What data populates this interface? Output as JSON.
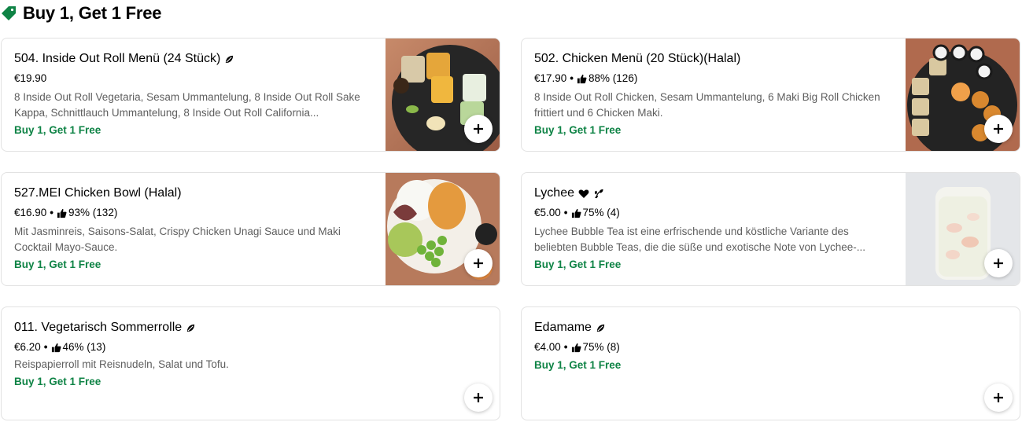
{
  "section": {
    "title": "Buy 1, Get 1 Free",
    "icon": "tag-icon"
  },
  "colors": {
    "promo": "#0e8345",
    "tag_icon": "#0e8345",
    "description": "#5e5e5e"
  },
  "items": [
    {
      "name": "504. Inside Out Roll Menü (24 Stück)",
      "icons": [
        "leaf-icon"
      ],
      "price": "€19.90",
      "rating": "",
      "description": "8 Inside Out Roll Vegetaria, Sesam Ummantelung, 8 Inside Out Roll Sake Kappa, Schnittlauch Ummantelung, 8 Inside Out Roll California...",
      "promo": "Buy 1, Get 1 Free",
      "image": "sushi-platter-image"
    },
    {
      "name": "502. Chicken Menü (20 Stück)(Halal)",
      "icons": [],
      "price": "€17.90",
      "rating": "88% (126)",
      "description": "8 Inside Out Roll Chicken, Sesam Ummantelung, 6 Maki Big Roll Chicken frittiert und 6 Chicken Maki.",
      "promo": "Buy 1, Get 1 Free",
      "image": "chicken-sushi-platter-image"
    },
    {
      "name": "527.MEI Chicken Bowl (Halal)",
      "icons": [],
      "price": "€16.90",
      "rating": "93% (132)",
      "description": "Mit Jasminreis, Saisons-Salat, Crispy Chicken Unagi Sauce und Maki Cocktail Mayo-Sauce.",
      "promo": "Buy 1, Get 1 Free",
      "image": "chicken-bowl-image"
    },
    {
      "name": "Lychee",
      "icons": [
        "heart-icon",
        "vegan-icon"
      ],
      "price": "€5.00",
      "rating": "75% (4)",
      "description": "Lychee Bubble Tea ist eine erfrischende und köstliche Variante des beliebten Bubble Teas, die die süße und exotische Note von Lychee-...",
      "promo": "Buy 1, Get 1 Free",
      "image": "bubble-tea-image"
    },
    {
      "name": "011. Vegetarisch Sommerrolle",
      "icons": [
        "leaf-icon"
      ],
      "price": "€6.20",
      "rating": "46% (13)",
      "description": "Reispapierroll mit Reisnudeln, Salat und Tofu.",
      "promo": "Buy 1, Get 1 Free",
      "image": ""
    },
    {
      "name": "Edamame",
      "icons": [
        "leaf-icon"
      ],
      "price": "€4.00",
      "rating": "75% (8)",
      "description": "",
      "promo": "Buy 1, Get 1 Free",
      "image": ""
    }
  ]
}
